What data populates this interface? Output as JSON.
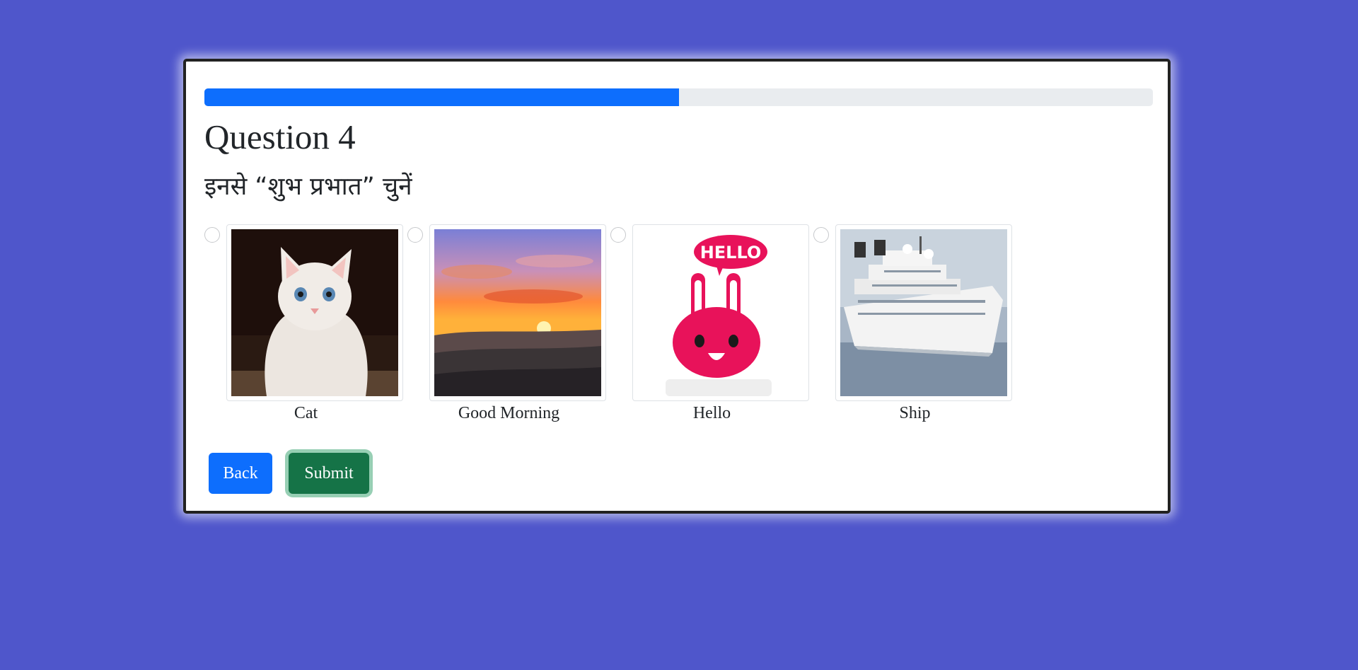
{
  "progress": {
    "fraction": 0.5
  },
  "question": {
    "title": "Question 4",
    "prompt": "इनसे “शुभ प्रभात” चुनें"
  },
  "options": [
    {
      "label": "Cat",
      "icon": "cat-image"
    },
    {
      "label": "Good Morning",
      "icon": "sunrise-image"
    },
    {
      "label": "Hello",
      "icon": "hello-bunny-image"
    },
    {
      "label": "Ship",
      "icon": "cruise-ship-image"
    }
  ],
  "buttons": {
    "back_label": "Back",
    "submit_label": "Submit"
  },
  "colors": {
    "background": "#4f56cb",
    "progress_fill": "#0d6efd",
    "back_button": "#0d6efd",
    "submit_button": "#157347"
  }
}
